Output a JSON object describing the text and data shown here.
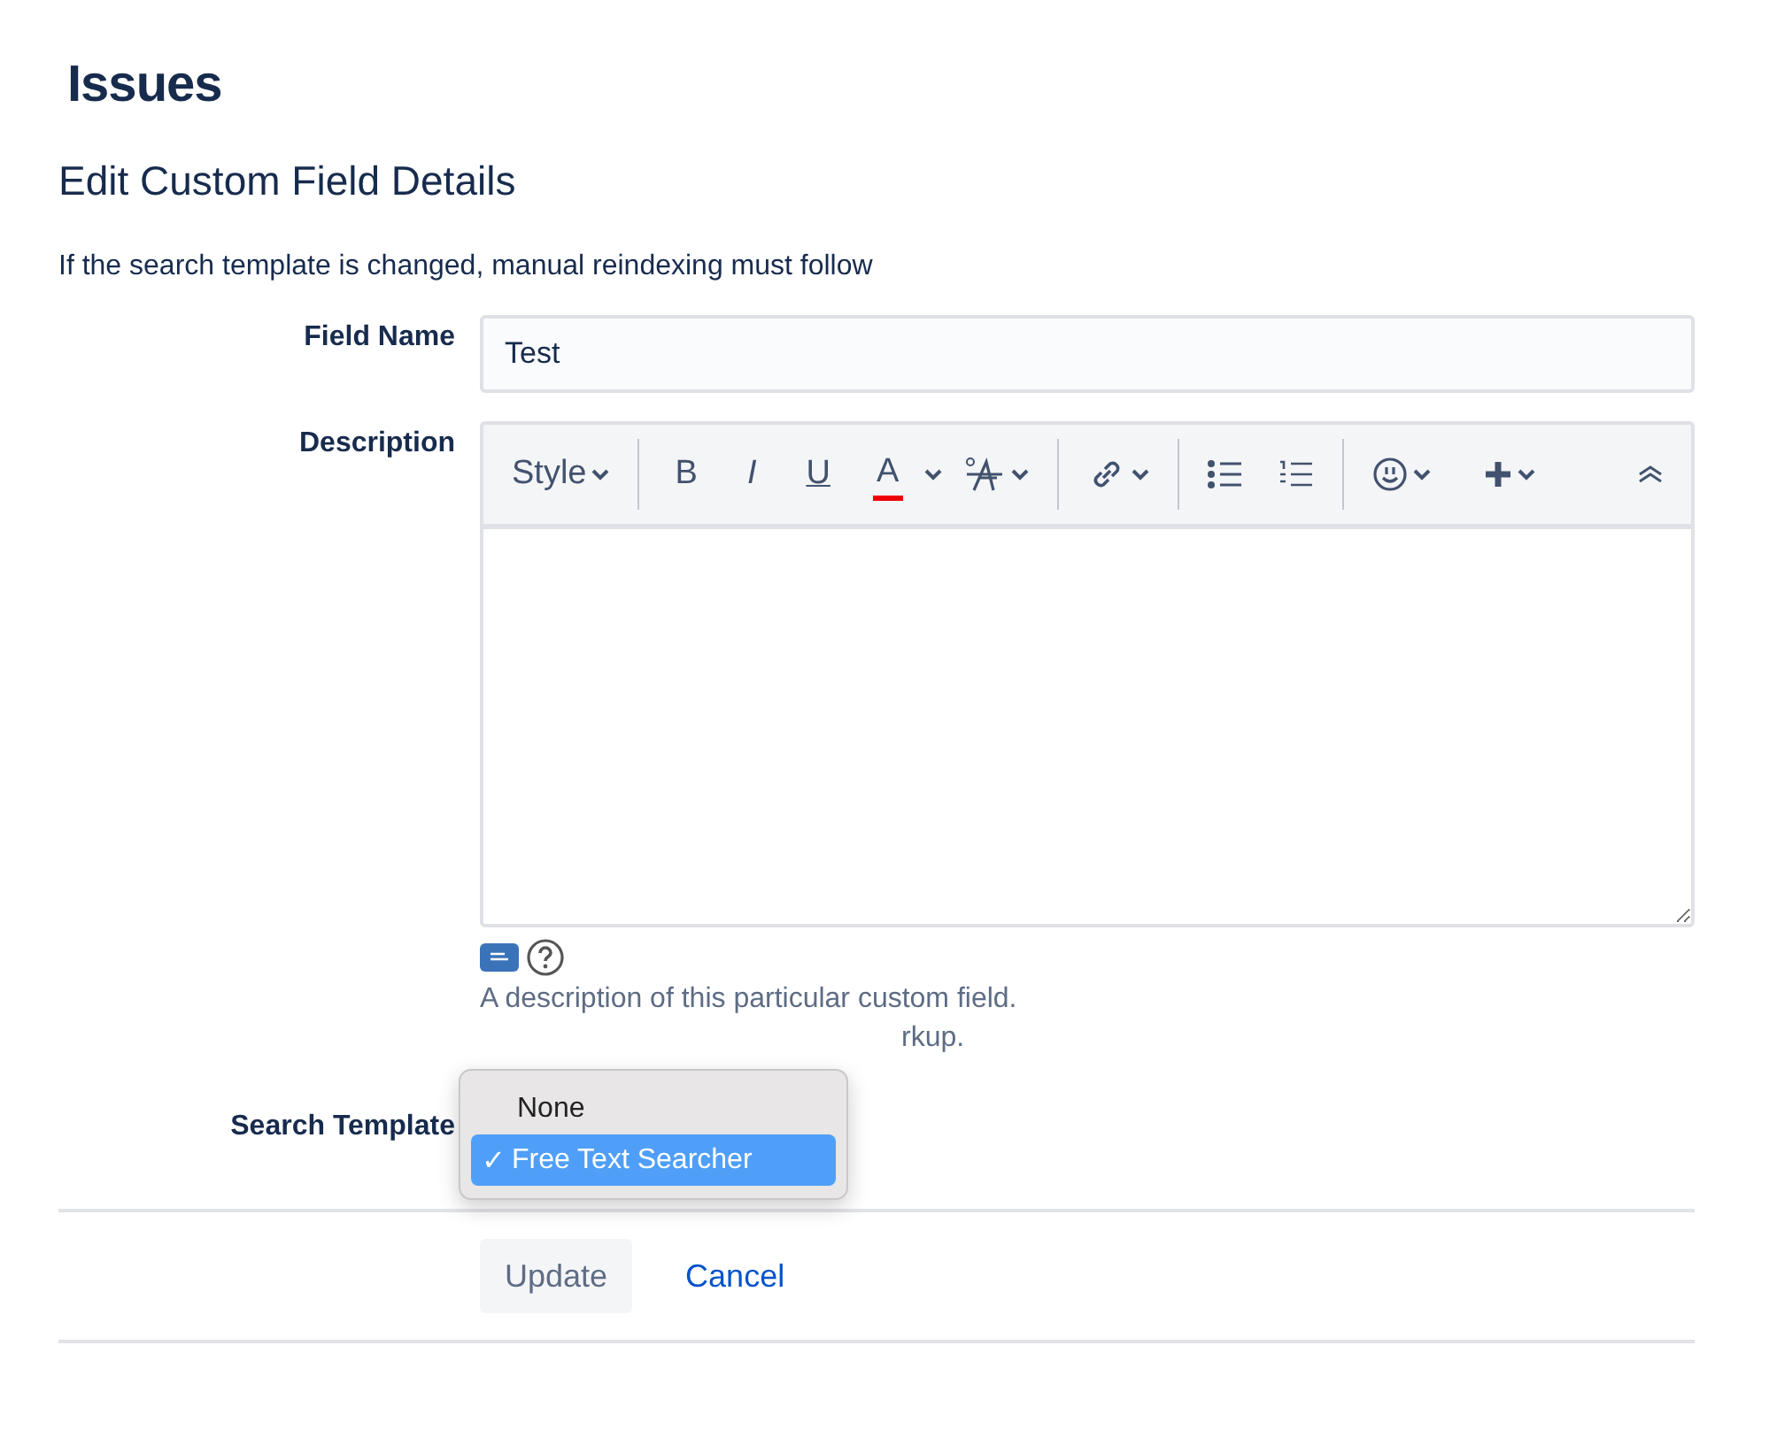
{
  "page_title": "Issues",
  "heading": "Edit Custom Field Details",
  "note": "If the search template is changed, manual reindexing must follow",
  "field_name": {
    "label": "Field Name",
    "value": "Test"
  },
  "description": {
    "label": "Description",
    "toolbar": {
      "style": "Style",
      "bold": "B",
      "italic": "I",
      "underline": "U",
      "font_color_letter": "A"
    },
    "hint": "A description of this particular custom field.",
    "hint_tail": "rkup."
  },
  "search_template": {
    "label": "Search Template",
    "check_mark": "✓",
    "options": [
      {
        "label": "None",
        "selected": false
      },
      {
        "label": "Free Text Searcher",
        "selected": true
      }
    ]
  },
  "buttons": {
    "update": "Update",
    "cancel": "Cancel"
  }
}
